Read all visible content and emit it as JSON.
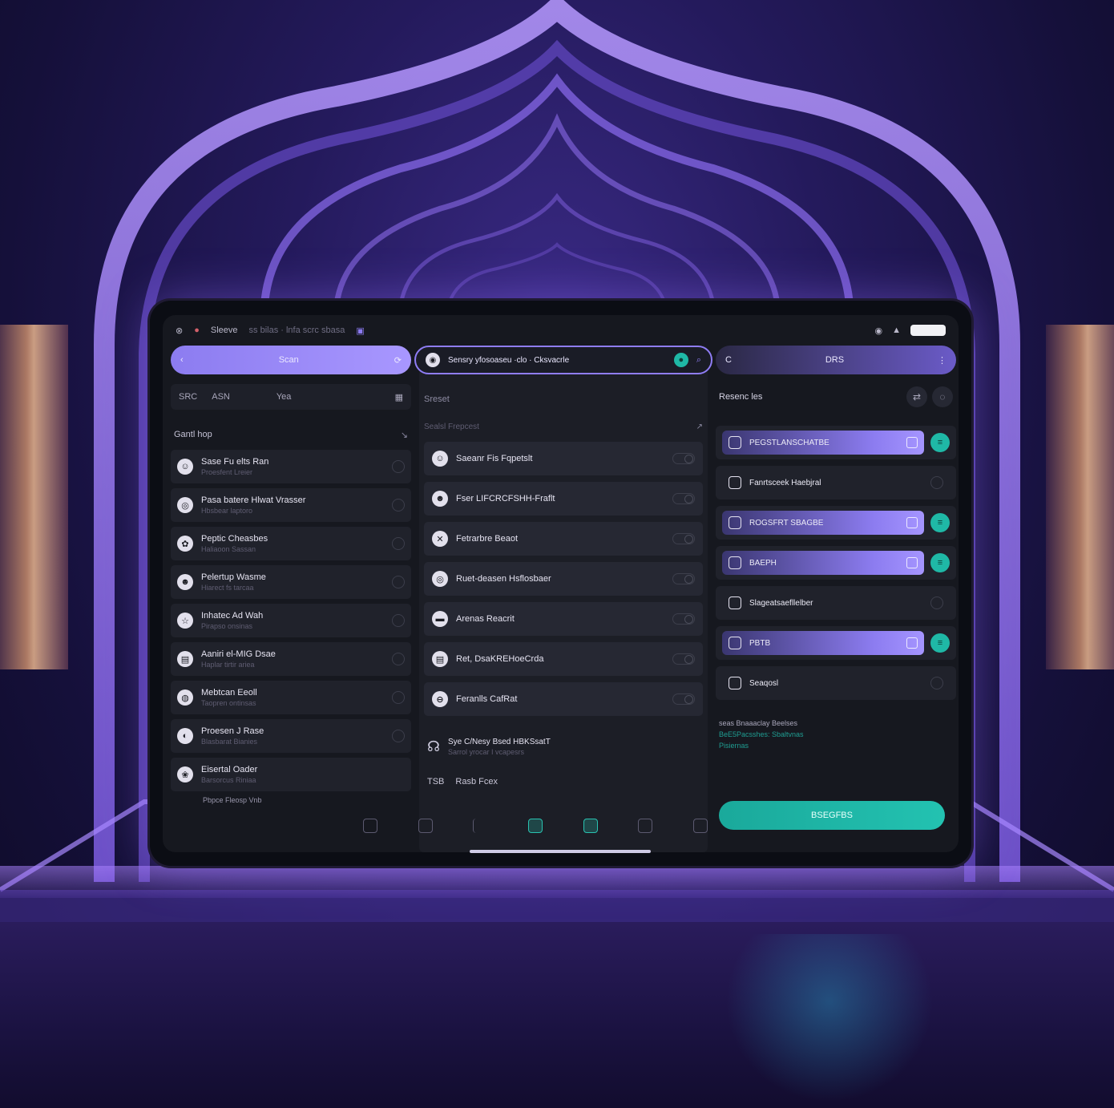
{
  "status_bar": {
    "app_name": "Sleeve",
    "mid_text": "ss bilas · lnfa scrc sbasa",
    "icons": [
      "wifi-icon",
      "signal-icon",
      "battery-icon"
    ]
  },
  "column1": {
    "top_pill_label": "Scan",
    "filter": {
      "a": "SRC",
      "b": "ASN",
      "c": "Yea"
    },
    "section_title": "Gantl hop",
    "items": [
      {
        "title": "Sase Fu elts Ran",
        "sub": "Proesfent Lreier"
      },
      {
        "title": "Pasa batere Hlwat Vrasser",
        "sub": "Hbsbear laptoro"
      },
      {
        "title": "Peptic Cheasbes",
        "sub": "Haliaoon Sassan"
      },
      {
        "title": "Pelertup Wasme",
        "sub": "Hiarect fs tarcaa"
      },
      {
        "title": "Inhatec Ad Wah",
        "sub": "Pirapso onsinas"
      },
      {
        "title": "Aaniri el-MIG Dsae",
        "sub": "Haplar tirtir ariea"
      },
      {
        "title": "Mebtcan Eeoll",
        "sub": "Taopren ontinsas"
      },
      {
        "title": "Proesen J Rase",
        "sub": "Blasbarat Bianies"
      },
      {
        "title": "Eisertal Oader",
        "sub": "Barsorcus Riniaa"
      }
    ],
    "overflow_text": "Pbpce Fleosp Vnb"
  },
  "column2": {
    "search_text": "Sensry yfosoaseu  ·clo  ·  Cksvacrle",
    "header": "Sreset",
    "subheader": "Sealsl Frepcest",
    "items": [
      "Saeanr Fis Fqpetslt",
      "Fser LIFCRCFSHH-Fraflt",
      "Fetrarbre Beaot",
      "Ruet-deasen Hsflosbaer",
      "Arenas Reacrit",
      "Ret, DsaKREHoeCrda",
      "Feranlls CafRat"
    ],
    "extra_title": "Sye C/Nesy Bsed HBKSsatT",
    "extra_sub": "Sarrol yrocar I vcapesrs",
    "footer_code": "TSB",
    "footer_label": "Rasb Fcex"
  },
  "column3": {
    "top_pill_label": "DRS",
    "header_title": "Resenc les",
    "rows": [
      {
        "label": "PEGSTLANSCHATBE",
        "active": true
      },
      {
        "label": "Fanrtsceek Haebjral",
        "active": false
      },
      {
        "label": "ROGSFRT SBAGBE",
        "active": true
      },
      {
        "label": "BAEPH",
        "active": true
      },
      {
        "label": "Slageatsaefllelber",
        "active": false
      },
      {
        "label": "PBTB",
        "active": true
      },
      {
        "label": "Seaqosl",
        "active": false
      }
    ],
    "note_line1": "seas Bnaaaclay Beelses",
    "note_line2": "BeE5Pacsshes: Sbaltvnas",
    "note_line3": "Pisiernas",
    "cta_label": "BSEGFBS"
  },
  "colors": {
    "accent_purple": "#8c7cf0",
    "accent_teal": "#1fb8a6",
    "panel": "#16181f"
  }
}
